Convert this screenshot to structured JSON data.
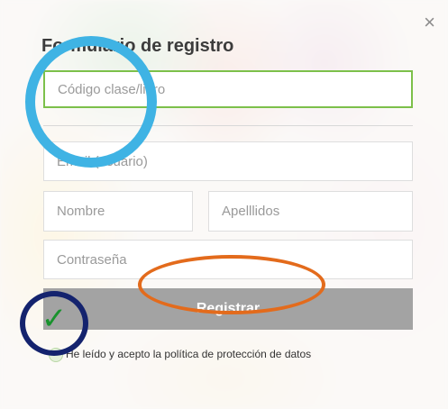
{
  "dialog": {
    "title": "Formulario de registro",
    "close_icon": "close-icon"
  },
  "form": {
    "code_placeholder": "Código clase/libro",
    "email_placeholder": "Email (usuario)",
    "name_placeholder": "Nombre",
    "surname_placeholder": "Apelllidos",
    "password_placeholder": "Contraseña",
    "register_label": "Registrar",
    "policy_text": "He leído y acepto la política de protección de datos"
  },
  "annotations": {
    "checkmark": "✓",
    "colors": {
      "blue_circle": "#3fb3e4",
      "orange_ellipse": "#e36b1c",
      "navy_circle": "#14236e",
      "check_mark": "#19922d"
    }
  },
  "colors": {
    "accent_border": "#7cc04a",
    "button_bg": "#a3a3a3"
  }
}
